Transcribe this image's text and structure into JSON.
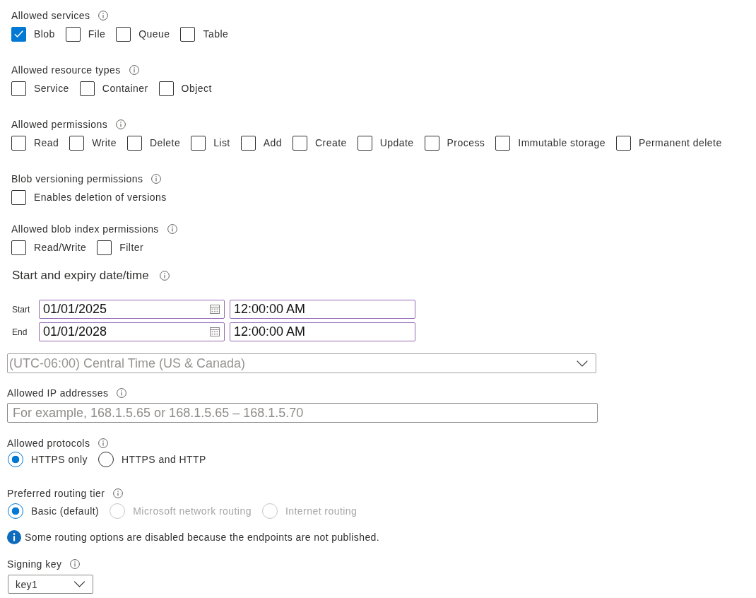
{
  "checkbox_groups": [
    {
      "label": "Allowed services",
      "options": [
        {
          "label": "Blob",
          "checked": true
        },
        {
          "label": "File",
          "checked": false
        },
        {
          "label": "Queue",
          "checked": false
        },
        {
          "label": "Table",
          "checked": false
        }
      ]
    },
    {
      "label": "Allowed resource types",
      "options": [
        {
          "label": "Service",
          "checked": false
        },
        {
          "label": "Container",
          "checked": false
        },
        {
          "label": "Object",
          "checked": false
        }
      ]
    },
    {
      "label": "Allowed permissions",
      "options": [
        {
          "label": "Read",
          "checked": false
        },
        {
          "label": "Write",
          "checked": false
        },
        {
          "label": "Delete",
          "checked": false
        },
        {
          "label": "List",
          "checked": false
        },
        {
          "label": "Add",
          "checked": false
        },
        {
          "label": "Create",
          "checked": false
        },
        {
          "label": "Update",
          "checked": false
        },
        {
          "label": "Process",
          "checked": false
        },
        {
          "label": "Immutable storage",
          "checked": false
        },
        {
          "label": "Permanent delete",
          "checked": false
        }
      ]
    },
    {
      "label": "Blob versioning permissions",
      "options": [
        {
          "label": "Enables deletion of versions",
          "checked": false
        }
      ]
    },
    {
      "label": "Allowed blob index permissions",
      "options": [
        {
          "label": "Read/Write",
          "checked": false
        },
        {
          "label": "Filter",
          "checked": false
        }
      ]
    }
  ],
  "start_expiry": {
    "title": "Start and expiry date/time",
    "rows": [
      {
        "label": "Start",
        "date": "01/01/2025",
        "time": "12:00:00 AM"
      },
      {
        "label": "End",
        "date": "01/01/2028",
        "time": "12:00:00 AM"
      }
    ],
    "timezone": "(UTC-06:00) Central Time (US & Canada)"
  },
  "allowed_ip_addresses": {
    "label": "Allowed IP addresses",
    "placeholder": "For example, 168.1.5.65 or 168.1.5.65 – 168.1.5.70"
  },
  "allowed_protocols": {
    "label": "Allowed protocols",
    "options": [
      {
        "label": "HTTPS only",
        "selected": true
      },
      {
        "label": "HTTPS and HTTP",
        "selected": false
      }
    ]
  },
  "routing_tier": {
    "label": "Preferred routing tier",
    "options": [
      {
        "label": "Basic (default)",
        "selected": true,
        "disabled": false
      },
      {
        "label": "Microsoft network routing",
        "selected": false,
        "disabled": true
      },
      {
        "label": "Internet routing",
        "selected": false,
        "disabled": true
      }
    ],
    "note": "Some routing options are disabled because the endpoints are not published."
  },
  "signing_key": {
    "label": "Signing key",
    "value": "key1"
  }
}
